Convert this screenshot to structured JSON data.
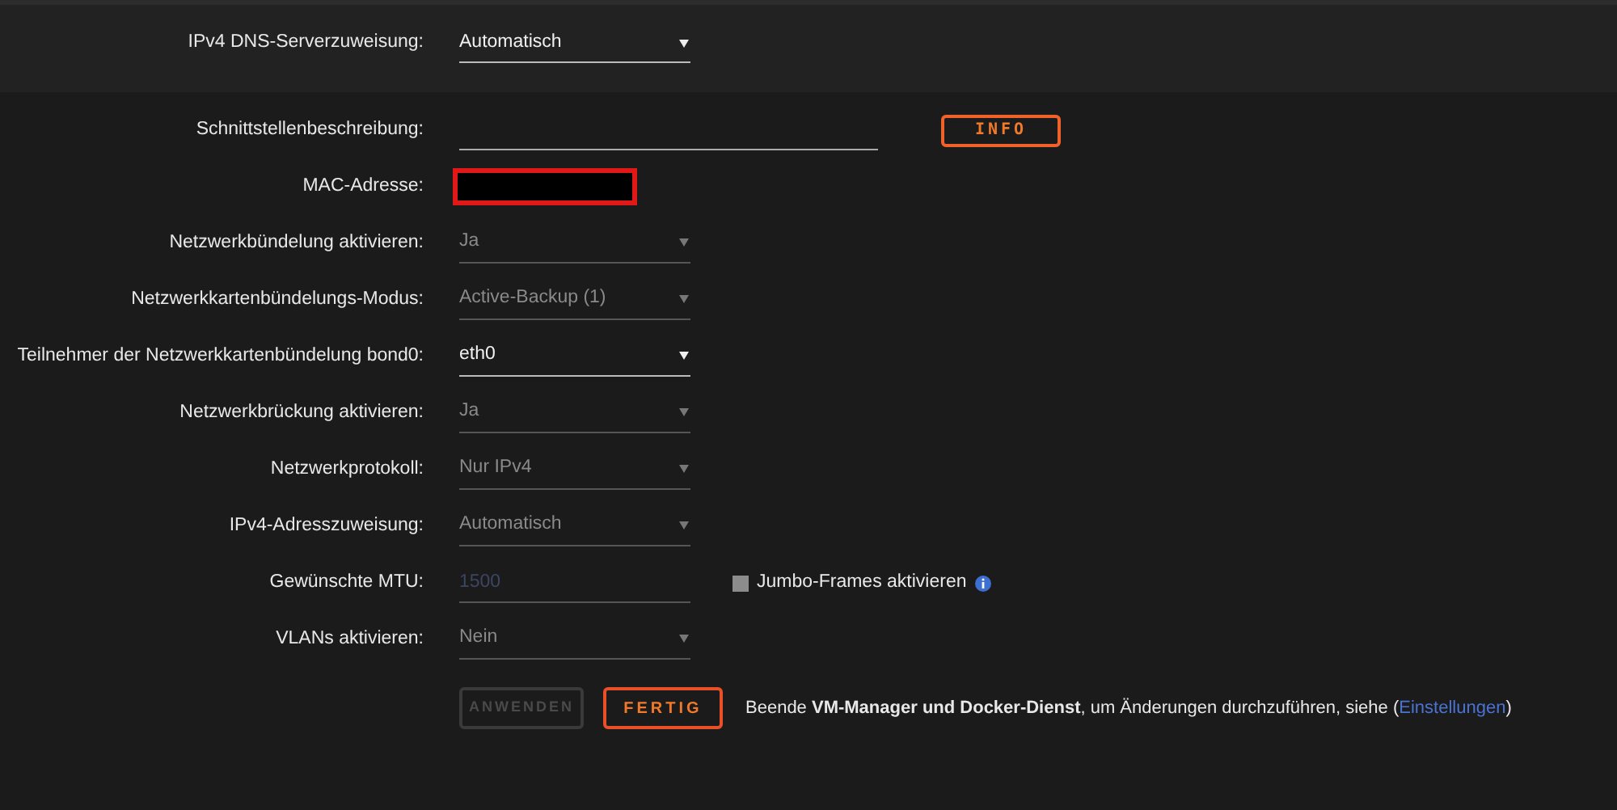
{
  "dns": {
    "label": "IPv4 DNS-Serverzuweisung:",
    "value": "Automatisch",
    "disabled": false
  },
  "rows": [
    {
      "kind": "text",
      "label": "Schnittstellenbeschreibung:",
      "button": "INFO"
    },
    {
      "kind": "redacted",
      "label": "MAC-Adresse:"
    },
    {
      "kind": "select",
      "label": "Netzwerkbündelung aktivieren:",
      "value": "Ja",
      "disabled": true
    },
    {
      "kind": "select",
      "label": "Netzwerkkartenbündelungs-Modus:",
      "value": "Active-Backup (1)",
      "disabled": true
    },
    {
      "kind": "select",
      "label": "Teilnehmer der Netzwerkkartenbündelung bond0:",
      "value": "eth0",
      "disabled": false
    },
    {
      "kind": "select",
      "label": "Netzwerkbrückung aktivieren:",
      "value": "Ja",
      "disabled": true
    },
    {
      "kind": "select",
      "label": "Netzwerkprotokoll:",
      "value": "Nur IPv4",
      "disabled": true
    },
    {
      "kind": "select",
      "label": "IPv4-Adresszuweisung:",
      "value": "Automatisch",
      "disabled": true
    },
    {
      "kind": "mtu",
      "label": "Gewünschte MTU:",
      "placeholder": "1500",
      "checkbox": {
        "label": "Jumbo-Frames aktivieren",
        "checked": false
      }
    },
    {
      "kind": "select",
      "label": "VLANs aktivieren:",
      "value": "Nein",
      "disabled": true
    }
  ],
  "actions": {
    "apply": {
      "label": "ANWENDEN",
      "disabled": true
    },
    "done": {
      "label": "FERTIG",
      "disabled": false
    },
    "note": "Beende **VM-Manager und Docker-Dienst**, um Änderungen durchzuführen, siehe (",
    "link": "Einstellungen",
    "note_end": ")"
  }
}
